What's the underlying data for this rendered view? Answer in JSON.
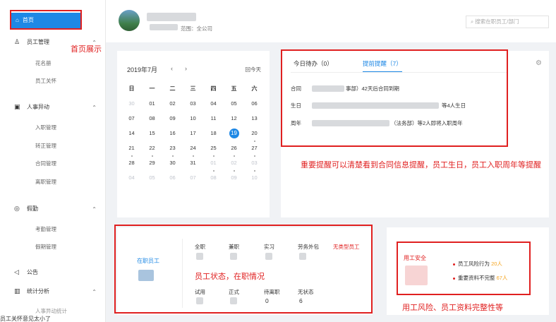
{
  "sidebar": {
    "home_label": "首页",
    "groups": [
      {
        "label": "员工管理",
        "subs": [
          "花名册",
          "员工关怀"
        ]
      },
      {
        "label": "人事异动",
        "subs": [
          "入职管理",
          "转正管理",
          "合同管理",
          "离职管理"
        ]
      },
      {
        "label": "假勤",
        "subs": [
          "考勤管理",
          "假期管理"
        ]
      },
      {
        "label": "公告",
        "subs": []
      },
      {
        "label": "统计分析",
        "subs": [
          "人事异动统计"
        ]
      }
    ]
  },
  "header": {
    "scope_text": "范围：全公司",
    "search_placeholder": "搜索在职员工/部门"
  },
  "calendar": {
    "month_label": "2019年7月",
    "prev": "‹",
    "next": "›",
    "today": "回今天",
    "weekdays": [
      "日",
      "一",
      "二",
      "三",
      "四",
      "五",
      "六"
    ],
    "weeks": [
      [
        "30",
        "01",
        "02",
        "03",
        "04",
        "05",
        "06"
      ],
      [
        "07",
        "08",
        "09",
        "10",
        "11",
        "12",
        "13"
      ],
      [
        "14",
        "15",
        "16",
        "17",
        "18",
        "19",
        "20"
      ],
      [
        "21",
        "22",
        "23",
        "24",
        "25",
        "26",
        "27"
      ],
      [
        "28",
        "29",
        "30",
        "31",
        "01",
        "02",
        "03"
      ],
      [
        "04",
        "05",
        "06",
        "07",
        "08",
        "09",
        "10"
      ]
    ]
  },
  "reminders": {
    "tab_todo": "今日待办（0）",
    "tab_advance": "提前提醒（7）",
    "rows": [
      {
        "label": "合同",
        "text": "事部）42天后合同到期"
      },
      {
        "label": "生日",
        "text": "等4人生日"
      },
      {
        "label": "周年",
        "text": "（法务部）等2人即将入职周年"
      }
    ]
  },
  "employees": {
    "on_job_label": "在职员工",
    "headers_top": [
      "全职",
      "兼职",
      "实习",
      "劳务外包",
      "无类型员工"
    ],
    "headers_bottom": [
      "试用",
      "正式",
      "待离职",
      "无状态"
    ],
    "values_bottom": [
      "",
      "",
      "0",
      "6"
    ]
  },
  "risk": {
    "title": "用工安全",
    "rows": [
      {
        "label": "员工风险行为",
        "value": "20人"
      },
      {
        "label": "重要资料不完整",
        "value": "67人"
      }
    ]
  },
  "annotations": {
    "home": "首页展示",
    "reminder": "重要提醒可以清楚看到合同信息提醒，员工生日，员工入职周年等提醒",
    "status": "员工状态，在职情况",
    "risk": "用工风险、员工资料完整性等"
  },
  "footnote": "员工关怀意见太小了"
}
